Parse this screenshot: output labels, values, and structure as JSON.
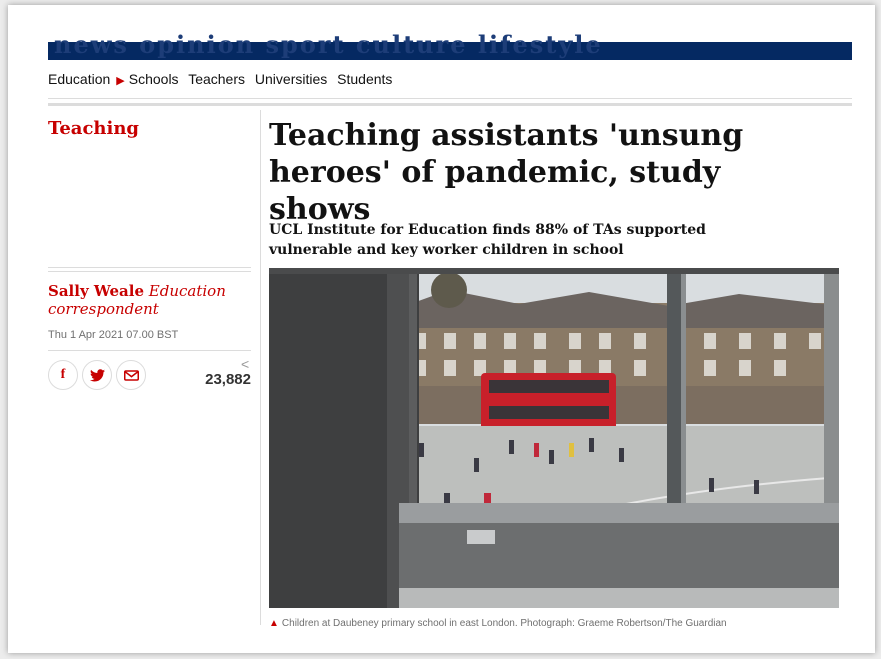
{
  "masthead": {
    "text": "news opinion sport culture lifestyle"
  },
  "nav": {
    "items": [
      {
        "label": "Education",
        "arrow": "▶"
      },
      {
        "label": "Schools"
      },
      {
        "label": "Teachers"
      },
      {
        "label": "Universities"
      },
      {
        "label": "Students"
      }
    ]
  },
  "article": {
    "section": "Teaching",
    "headline": "Teaching assistants 'unsung heroes' of pandemic, study shows",
    "standfirst": "UCL Institute for Education finds 88% of TAs supported vulnerable and key worker children in school",
    "author": "Sally Weale",
    "author_role": "Education correspondent",
    "date": "Thu 1 Apr 2021 07.00 BST",
    "share_count": "23,882",
    "caption": "Children at Daubeney primary school in east London. Photograph: Graeme Robertson/The Guardian"
  },
  "icons": {
    "facebook": "f",
    "twitter": "🐦",
    "email": "✉",
    "share": "<"
  },
  "colors": {
    "brand_navy": "#052962",
    "accent_red": "#c70000"
  }
}
